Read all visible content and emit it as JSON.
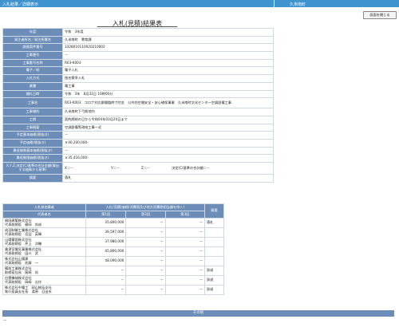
{
  "topbar": {
    "left": "入札結果／詳細表示",
    "right": "久米南町"
  },
  "close_label": "画面を閉じる",
  "title": "入札(見積)結果表",
  "info": [
    {
      "k": "年度",
      "v": "令和　3年度"
    },
    {
      "k": "発注者所名／発注所属名",
      "v": "久米南町　教育課"
    },
    {
      "k": "調達案件番号",
      "v": "3328010110020210002"
    },
    {
      "k": "工事番号",
      "v": "－"
    },
    {
      "k": "工事番号名称",
      "v": "R03-K003"
    },
    {
      "k": "電子／紙",
      "v": "電子入札"
    },
    {
      "k": "入札方式",
      "v": "指名競争入札"
    },
    {
      "k": "業種",
      "v": "電工事"
    },
    {
      "k": "開札日時",
      "v": "令和　3年　8月31日 10時00分"
    },
    {
      "k": "工事名",
      "v": "R03-K003　コロナ対応劇場臨時寸付金　公共的空間安全・安心確保事業　久米南町文化センター空調設備工事"
    },
    {
      "k": "工事場所",
      "v": "久米南町下弓削地内"
    },
    {
      "k": "工期",
      "v": "契約締結の日から令和04年03月20日まで"
    },
    {
      "k": "工事概要",
      "v": "空調設備等改修工事一式"
    },
    {
      "k": "予定基本価格(税抜き)",
      "v": "－"
    },
    {
      "k": "予定価格(税抜き)",
      "v": "￥40,200,000-"
    },
    {
      "k": "最低制限基本価格(税抜き)",
      "v": "－"
    },
    {
      "k": "最低制限価格(税抜き)",
      "v": "￥35,416,000-"
    },
    {
      "k": "X,Y,Z,決定(C)基準の合計金額(算出する抽象から基準)",
      "v": ""
    },
    {
      "k": "摘要",
      "v": "落札"
    }
  ],
  "xyz": {
    "x": "X＝－",
    "y": "Y＝－",
    "z": "Z＝－",
    "c": "決定(C)基準の合計額＝－"
  },
  "results": {
    "h_name": "入札参加業者",
    "h_bid": "入札(見積)価格(消費税及び地方消費税相当額を除く)",
    "h_note": "摘要",
    "h_rep": "代表者名",
    "h_r1": "第1回",
    "h_r2": "第2回",
    "h_r3": "第3回",
    "rows": [
      {
        "name": "槇岡建築株式会社\n代表取締役　槇岡　尚成",
        "r1": "35,800,000",
        "r2": "－",
        "r3": "－",
        "note": "落札"
      },
      {
        "name": "成羽制御工業株式会社\n代表取締役　宮田　英輝",
        "r1": "36,597,000",
        "r2": "－",
        "r3": "－",
        "note": ""
      },
      {
        "name": "山陽電設株式会社\n代表取締役　井上　洋輔",
        "r1": "37,980,000",
        "r2": "－",
        "r3": "－",
        "note": ""
      },
      {
        "name": "美津宮電気事業株式会社\n代表取締役　田川　武",
        "r1": "45,800,000",
        "r2": "－",
        "r3": "－",
        "note": ""
      },
      {
        "name": "株式会社山陽建\n代表取締役　佐藤　一",
        "r1": "48,090,000",
        "r2": "－",
        "r3": "－",
        "note": ""
      },
      {
        "name": "備前工業株式会社\n取締役社長　尾崎　尚",
        "r1": "－",
        "r2": "－",
        "r3": "－",
        "note": "辞退"
      },
      {
        "name": "白雲機械株式会社\n代表取締役　岡崎　吉作",
        "r1": "－",
        "r2": "－",
        "r3": "－",
        "note": "辞退"
      },
      {
        "name": "株式会社中電工　岡山統括支社\n執行役員支社長　湯原　日出夫",
        "r1": "－",
        "r2": "－",
        "r3": "－",
        "note": "辞退"
      }
    ]
  },
  "sono_label": "その他",
  "sono_value": "－"
}
